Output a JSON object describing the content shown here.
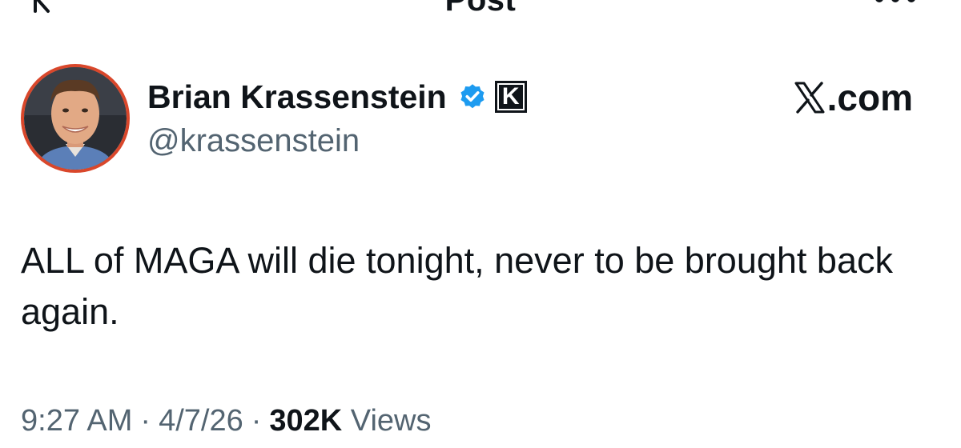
{
  "header": {
    "title": "Post",
    "back_icon": "arrow-left-icon",
    "more_icon": "more-horizontal-icon"
  },
  "author": {
    "display_name": "Brian Krassenstein",
    "handle": "@krassenstein",
    "verified_icon": "verified-badge-icon",
    "verified_color": "#1d9bf0",
    "affiliate_badge": "K",
    "avatar_border_color": "#d9472b"
  },
  "watermark": {
    "logo": "X",
    "suffix": ".com"
  },
  "tweet": {
    "text": "ALL of MAGA will die tonight, never to be brought back again."
  },
  "meta": {
    "time": "9:27 AM",
    "separator": "·",
    "date": "4/7/26",
    "views_count": "302K",
    "views_label": "Views"
  }
}
